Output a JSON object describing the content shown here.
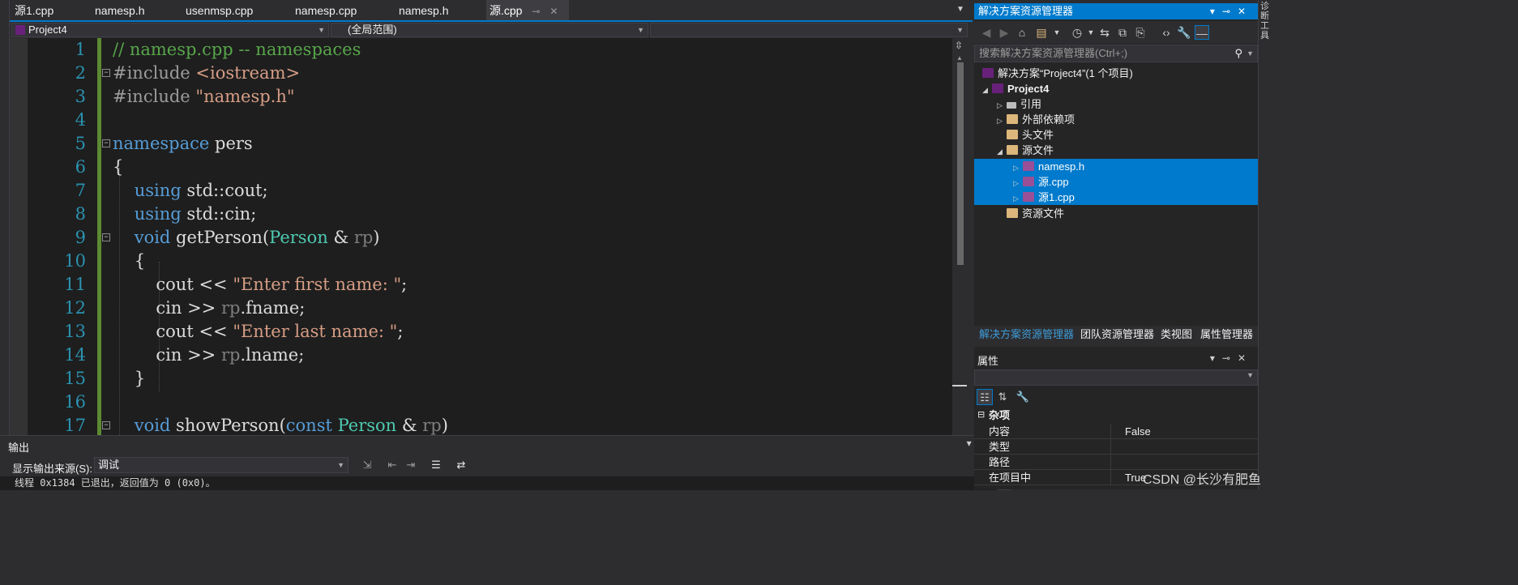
{
  "tabs": [
    {
      "label": "源1.cpp",
      "active": false
    },
    {
      "label": "namesp.h",
      "active": false
    },
    {
      "label": "usenmsp.cpp",
      "active": false
    },
    {
      "label": "namesp.cpp",
      "active": false
    },
    {
      "label": "namesp.h",
      "active": false
    },
    {
      "label": "源.cpp",
      "active": true
    }
  ],
  "navbar": {
    "project": "Project4",
    "scope": "(全局范围)",
    "member": ""
  },
  "editor": {
    "line_numbers": [
      "1",
      "2",
      "3",
      "4",
      "5",
      "6",
      "7",
      "8",
      "9",
      "10",
      "11",
      "12",
      "13",
      "14",
      "15",
      "16",
      "17"
    ]
  },
  "output": {
    "title": "输出",
    "source_label": "显示输出来源(S):",
    "source_value": "调试",
    "text": "线程 0x1384 已退出，返回值为 0 (0x0)。"
  },
  "solution_explorer": {
    "title": "解决方案资源管理器",
    "search_placeholder": "搜索解决方案资源管理器(Ctrl+;)",
    "solution_label": "解决方案“Project4”(1 个项目)",
    "project_label": "Project4",
    "items": [
      {
        "label": "引用"
      },
      {
        "label": "外部依赖项"
      },
      {
        "label": "头文件"
      },
      {
        "label": "源文件"
      },
      {
        "label": "namesp.h"
      },
      {
        "label": "源.cpp"
      },
      {
        "label": "源1.cpp"
      },
      {
        "label": "资源文件"
      }
    ],
    "bottom_tabs": [
      "解决方案资源管理器",
      "团队资源管理器",
      "类视图",
      "属性管理器"
    ]
  },
  "properties": {
    "title": "属性",
    "category": "杂项",
    "rows": [
      {
        "key": "内容",
        "value": "False"
      },
      {
        "key": "类型",
        "value": ""
      },
      {
        "key": "路径",
        "value": ""
      },
      {
        "key": "在项目中",
        "value": "True"
      }
    ]
  },
  "right_strip": {
    "text": "诊断工具"
  },
  "watermark": "CSDN @长沙有肥鱼",
  "colors": {
    "accent": "#007acc",
    "editor_bg": "#1e1e1e",
    "keyword": "#569cd6",
    "type": "#4ec9b0",
    "string": "#d69d85",
    "comment": "#57a64a",
    "line_number": "#2b91af"
  }
}
